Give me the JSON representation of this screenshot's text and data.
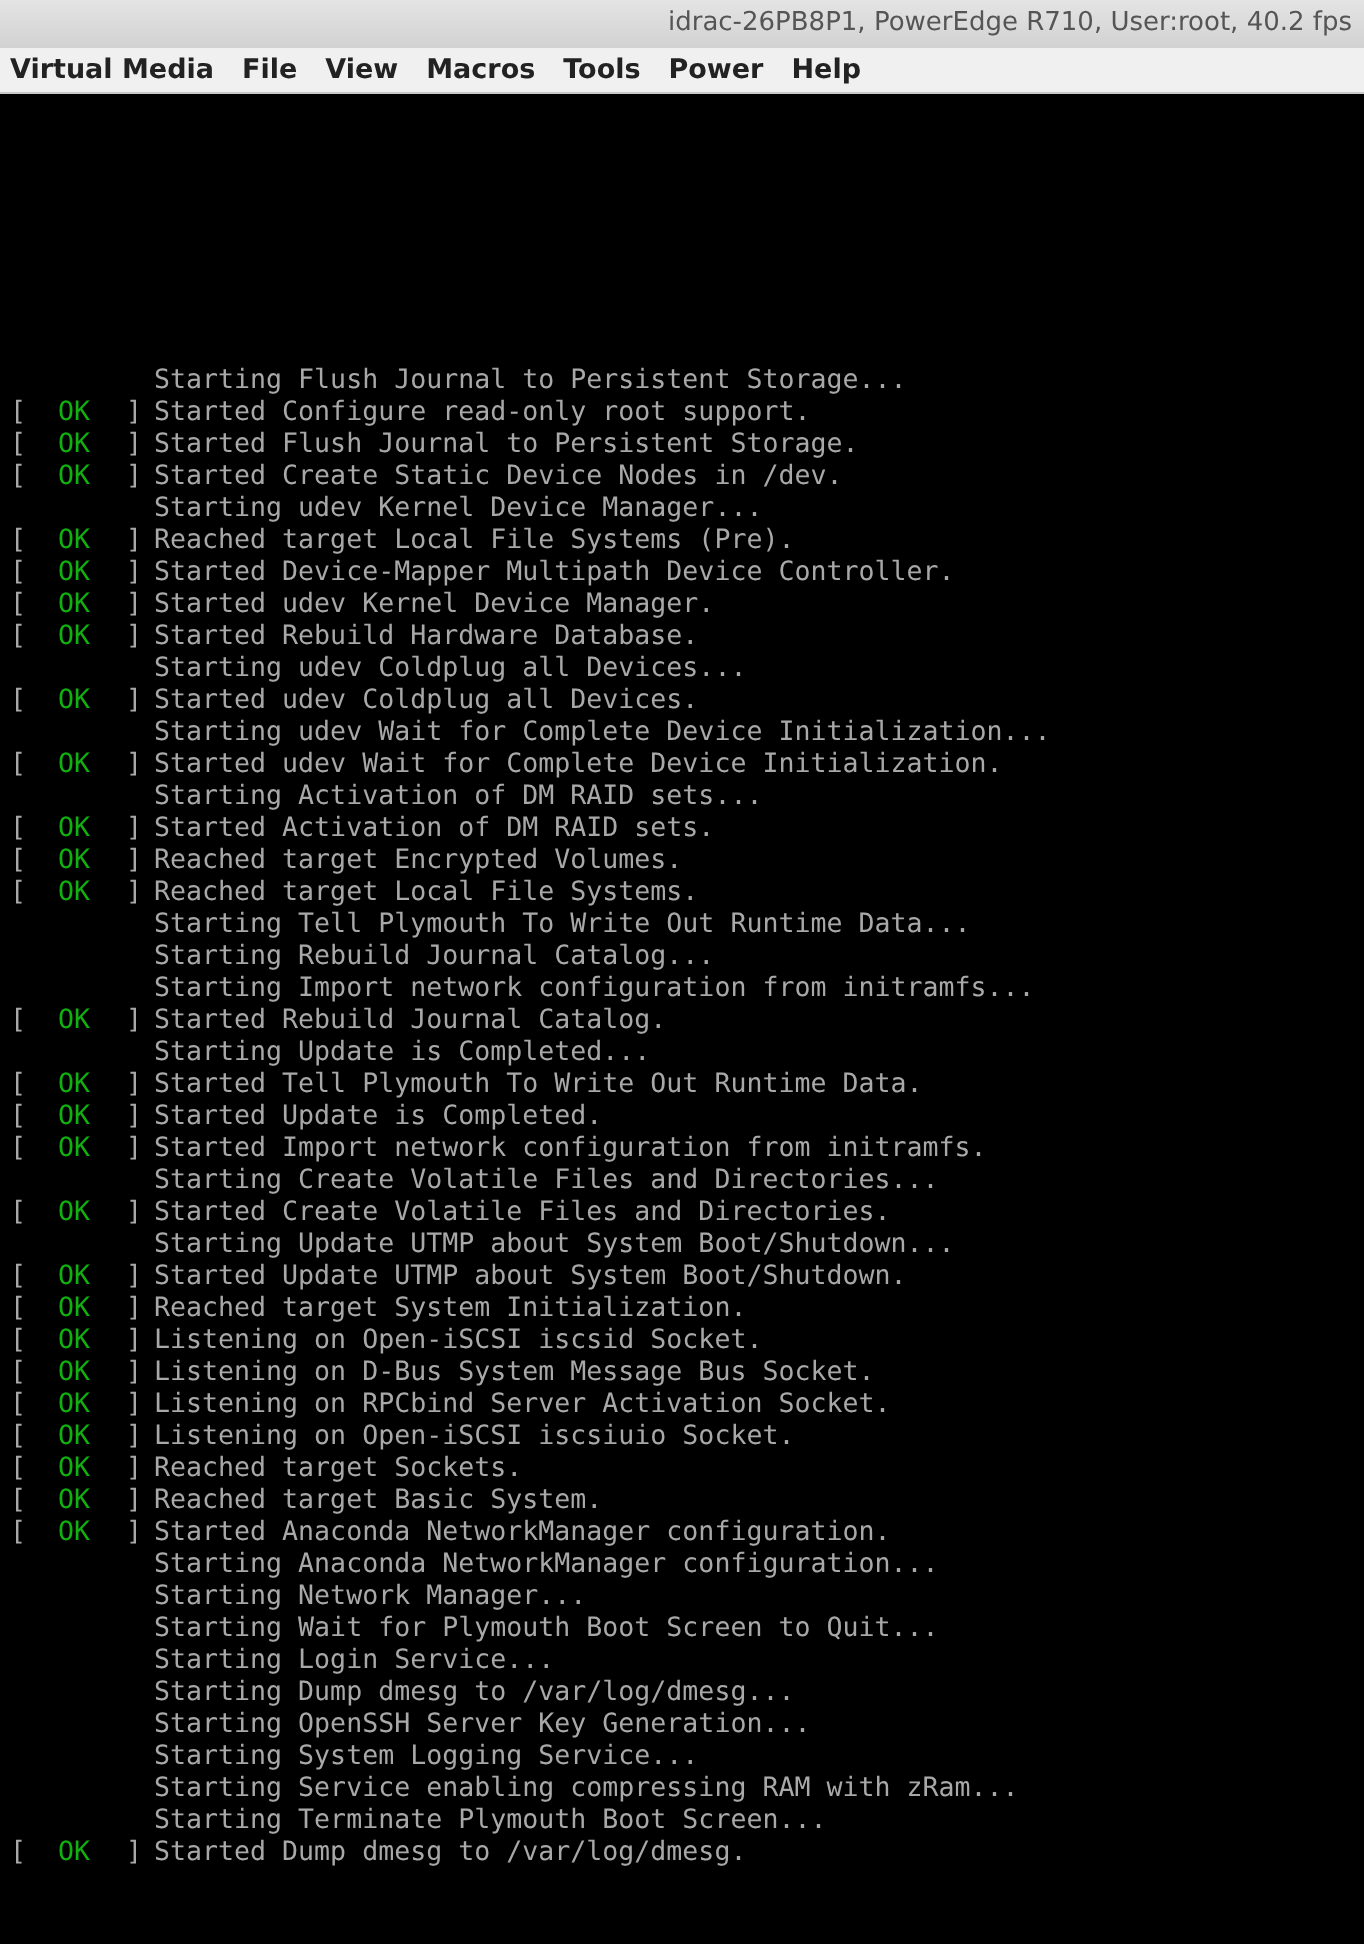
{
  "window": {
    "title": "idrac-26PB8P1, PowerEdge R710, User:root, 40.2 fps"
  },
  "menu": [
    "Virtual Media",
    "File",
    "View",
    "Macros",
    "Tools",
    "Power",
    "Help"
  ],
  "console": {
    "lines": [
      {
        "kind": "pending",
        "text": "Starting Flush Journal to Persistent Storage..."
      },
      {
        "kind": "ok",
        "status": {
          "open": "[",
          "label": "OK",
          "close": "]"
        },
        "text": "Started Configure read-only root support."
      },
      {
        "kind": "ok",
        "status": {
          "open": "[",
          "label": "OK",
          "close": "]"
        },
        "text": "Started Flush Journal to Persistent Storage."
      },
      {
        "kind": "ok",
        "status": {
          "open": "[",
          "label": "OK",
          "close": "]"
        },
        "text": "Started Create Static Device Nodes in /dev."
      },
      {
        "kind": "pending",
        "text": "Starting udev Kernel Device Manager..."
      },
      {
        "kind": "ok",
        "status": {
          "open": "[",
          "label": "OK",
          "close": "]"
        },
        "text": "Reached target Local File Systems (Pre)."
      },
      {
        "kind": "ok",
        "status": {
          "open": "[",
          "label": "OK",
          "close": "]"
        },
        "text": "Started Device-Mapper Multipath Device Controller."
      },
      {
        "kind": "ok",
        "status": {
          "open": "[",
          "label": "OK",
          "close": "]"
        },
        "text": "Started udev Kernel Device Manager."
      },
      {
        "kind": "ok",
        "status": {
          "open": "[",
          "label": "OK",
          "close": "]"
        },
        "text": "Started Rebuild Hardware Database."
      },
      {
        "kind": "pending",
        "text": "Starting udev Coldplug all Devices..."
      },
      {
        "kind": "ok",
        "status": {
          "open": "[",
          "label": "OK",
          "close": "]"
        },
        "text": "Started udev Coldplug all Devices."
      },
      {
        "kind": "pending",
        "text": "Starting udev Wait for Complete Device Initialization..."
      },
      {
        "kind": "ok",
        "status": {
          "open": "[",
          "label": "OK",
          "close": "]"
        },
        "text": "Started udev Wait for Complete Device Initialization."
      },
      {
        "kind": "pending",
        "text": "Starting Activation of DM RAID sets..."
      },
      {
        "kind": "ok",
        "status": {
          "open": "[",
          "label": "OK",
          "close": "]"
        },
        "text": "Started Activation of DM RAID sets."
      },
      {
        "kind": "ok",
        "status": {
          "open": "[",
          "label": "OK",
          "close": "]"
        },
        "text": "Reached target Encrypted Volumes."
      },
      {
        "kind": "ok",
        "status": {
          "open": "[",
          "label": "OK",
          "close": "]"
        },
        "text": "Reached target Local File Systems."
      },
      {
        "kind": "pending",
        "text": "Starting Tell Plymouth To Write Out Runtime Data..."
      },
      {
        "kind": "pending",
        "text": "Starting Rebuild Journal Catalog..."
      },
      {
        "kind": "pending",
        "text": "Starting Import network configuration from initramfs..."
      },
      {
        "kind": "ok",
        "status": {
          "open": "[",
          "label": "OK",
          "close": "]"
        },
        "text": "Started Rebuild Journal Catalog."
      },
      {
        "kind": "pending",
        "text": "Starting Update is Completed..."
      },
      {
        "kind": "ok",
        "status": {
          "open": "[",
          "label": "OK",
          "close": "]"
        },
        "text": "Started Tell Plymouth To Write Out Runtime Data."
      },
      {
        "kind": "ok",
        "status": {
          "open": "[",
          "label": "OK",
          "close": "]"
        },
        "text": "Started Update is Completed."
      },
      {
        "kind": "ok",
        "status": {
          "open": "[",
          "label": "OK",
          "close": "]"
        },
        "text": "Started Import network configuration from initramfs."
      },
      {
        "kind": "pending",
        "text": "Starting Create Volatile Files and Directories..."
      },
      {
        "kind": "ok",
        "status": {
          "open": "[",
          "label": "OK",
          "close": "]"
        },
        "text": "Started Create Volatile Files and Directories."
      },
      {
        "kind": "pending",
        "text": "Starting Update UTMP about System Boot/Shutdown..."
      },
      {
        "kind": "ok",
        "status": {
          "open": "[",
          "label": "OK",
          "close": "]"
        },
        "text": "Started Update UTMP about System Boot/Shutdown."
      },
      {
        "kind": "ok",
        "status": {
          "open": "[",
          "label": "OK",
          "close": "]"
        },
        "text": "Reached target System Initialization."
      },
      {
        "kind": "ok",
        "status": {
          "open": "[",
          "label": "OK",
          "close": "]"
        },
        "text": "Listening on Open-iSCSI iscsid Socket."
      },
      {
        "kind": "ok",
        "status": {
          "open": "[",
          "label": "OK",
          "close": "]"
        },
        "text": "Listening on D-Bus System Message Bus Socket."
      },
      {
        "kind": "ok",
        "status": {
          "open": "[",
          "label": "OK",
          "close": "]"
        },
        "text": "Listening on RPCbind Server Activation Socket."
      },
      {
        "kind": "ok",
        "status": {
          "open": "[",
          "label": "OK",
          "close": "]"
        },
        "text": "Listening on Open-iSCSI iscsiuio Socket."
      },
      {
        "kind": "ok",
        "status": {
          "open": "[",
          "label": "OK",
          "close": "]"
        },
        "text": "Reached target Sockets."
      },
      {
        "kind": "ok",
        "status": {
          "open": "[",
          "label": "OK",
          "close": "]"
        },
        "text": "Reached target Basic System."
      },
      {
        "kind": "ok",
        "status": {
          "open": "[",
          "label": "OK",
          "close": "]"
        },
        "text": "Started Anaconda NetworkManager configuration."
      },
      {
        "kind": "pending",
        "text": "Starting Anaconda NetworkManager configuration..."
      },
      {
        "kind": "pending",
        "text": "Starting Network Manager..."
      },
      {
        "kind": "pending",
        "text": "Starting Wait for Plymouth Boot Screen to Quit..."
      },
      {
        "kind": "pending",
        "text": "Starting Login Service..."
      },
      {
        "kind": "pending",
        "text": "Starting Dump dmesg to /var/log/dmesg..."
      },
      {
        "kind": "pending",
        "text": "Starting OpenSSH Server Key Generation..."
      },
      {
        "kind": "pending",
        "text": "Starting System Logging Service..."
      },
      {
        "kind": "pending",
        "text": "Starting Service enabling compressing RAM with zRam..."
      },
      {
        "kind": "pending",
        "text": "Starting Terminate Plymouth Boot Screen..."
      },
      {
        "kind": "ok",
        "status": {
          "open": "[",
          "label": "OK",
          "close": "]"
        },
        "text": "Started Dump dmesg to /var/log/dmesg."
      }
    ]
  }
}
